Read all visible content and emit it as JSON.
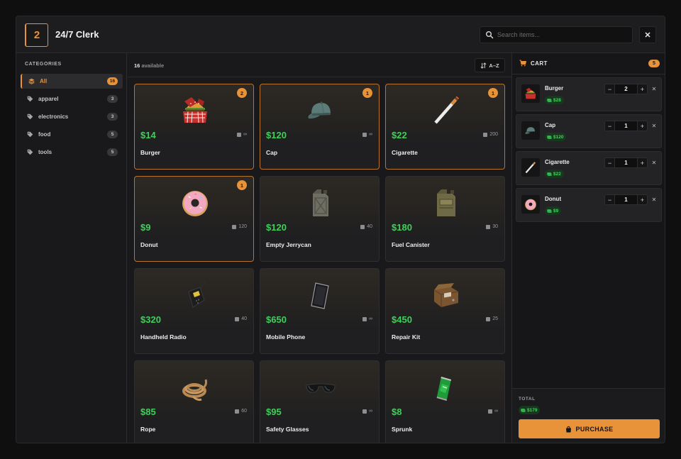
{
  "header": {
    "shop_id": "2",
    "title": "24/7 Clerk",
    "search_placeholder": "Search items...",
    "close_label": "✕"
  },
  "sidebar": {
    "title": "CATEGORIES",
    "items": [
      {
        "label": "All",
        "count": "16",
        "icon": "layers-icon",
        "active": true
      },
      {
        "label": "apparel",
        "count": "3",
        "icon": "tag-icon",
        "active": false
      },
      {
        "label": "electronics",
        "count": "3",
        "icon": "tag-icon",
        "active": false
      },
      {
        "label": "food",
        "count": "5",
        "icon": "tag-icon",
        "active": false
      },
      {
        "label": "tools",
        "count": "5",
        "icon": "tag-icon",
        "active": false
      }
    ]
  },
  "toolbar": {
    "available_count": "16",
    "available_label": "available",
    "sort_label": "A–Z"
  },
  "products": [
    {
      "name": "Burger",
      "price": "$14",
      "stock": "∞",
      "in_cart": "2",
      "icon": "burger-icon"
    },
    {
      "name": "Cap",
      "price": "$120",
      "stock": "∞",
      "in_cart": "1",
      "icon": "cap-icon"
    },
    {
      "name": "Cigarette",
      "price": "$22",
      "stock": "200",
      "in_cart": "1",
      "icon": "cigarette-icon"
    },
    {
      "name": "Donut",
      "price": "$9",
      "stock": "120",
      "in_cart": "1",
      "icon": "donut-icon"
    },
    {
      "name": "Empty Jerrycan",
      "price": "$120",
      "stock": "40",
      "in_cart": "",
      "icon": "jerrycan-icon"
    },
    {
      "name": "Fuel Canister",
      "price": "$180",
      "stock": "30",
      "in_cart": "",
      "icon": "fuel-canister-icon"
    },
    {
      "name": "Handheld Radio",
      "price": "$320",
      "stock": "40",
      "in_cart": "",
      "icon": "radio-icon"
    },
    {
      "name": "Mobile Phone",
      "price": "$650",
      "stock": "∞",
      "in_cart": "",
      "icon": "phone-icon"
    },
    {
      "name": "Repair Kit",
      "price": "$450",
      "stock": "25",
      "in_cart": "",
      "icon": "repair-kit-icon"
    },
    {
      "name": "Rope",
      "price": "$85",
      "stock": "60",
      "in_cart": "",
      "icon": "rope-icon"
    },
    {
      "name": "Safety Glasses",
      "price": "$95",
      "stock": "∞",
      "in_cart": "",
      "icon": "glasses-icon"
    },
    {
      "name": "Sprunk",
      "price": "$8",
      "stock": "∞",
      "in_cart": "",
      "icon": "soda-can-icon"
    }
  ],
  "cart": {
    "title": "CART",
    "count": "5",
    "items": [
      {
        "name": "Burger",
        "price": "$28",
        "qty": "2",
        "icon": "burger-icon"
      },
      {
        "name": "Cap",
        "price": "$120",
        "qty": "1",
        "icon": "cap-icon"
      },
      {
        "name": "Cigarette",
        "price": "$22",
        "qty": "1",
        "icon": "cigarette-icon"
      },
      {
        "name": "Donut",
        "price": "$9",
        "qty": "1",
        "icon": "donut-icon"
      }
    ],
    "total_label": "TOTAL",
    "total_value": "$179",
    "purchase_label": "PURCHASE"
  },
  "colors": {
    "accent": "#e8923a",
    "price_green": "#3fcf5a",
    "background": "#1c1c1e"
  }
}
